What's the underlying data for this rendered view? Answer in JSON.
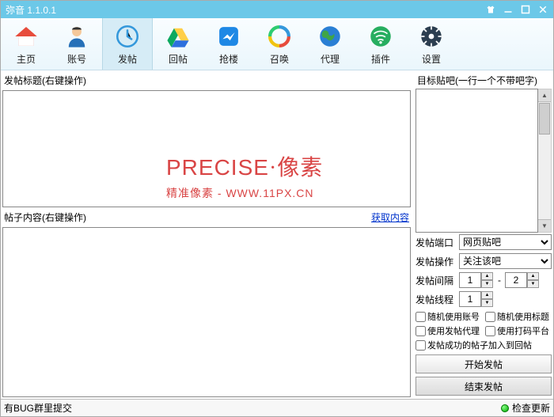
{
  "window": {
    "title": "弥音 1.1.0.1"
  },
  "toolbar": {
    "items": [
      {
        "label": "主页"
      },
      {
        "label": "账号"
      },
      {
        "label": "发帖",
        "active": true
      },
      {
        "label": "回帖"
      },
      {
        "label": "抢楼"
      },
      {
        "label": "召唤"
      },
      {
        "label": "代理"
      },
      {
        "label": "插件"
      },
      {
        "label": "设置"
      }
    ]
  },
  "left": {
    "title_label": "发帖标题(右键操作)",
    "content_label": "帖子内容(右键操作)",
    "get_content_link": "获取内容"
  },
  "right": {
    "target_label": "目标贴吧(一行一个不带吧字)",
    "post_port_label": "发帖端口",
    "post_port_value": "网页贴吧",
    "post_action_label": "发帖操作",
    "post_action_value": "关注该吧",
    "interval_label": "发帖间隔",
    "interval_min": "1",
    "interval_max": "2",
    "threads_label": "发帖线程",
    "threads_value": "1",
    "checks": {
      "rand_account": "随机使用账号",
      "rand_title": "随机使用标题",
      "use_proxy": "使用发帖代理",
      "use_coding": "使用打码平台",
      "add_to_reply": "发帖成功的帖子加入到回帖"
    },
    "start_btn": "开始发帖",
    "stop_btn": "结束发帖"
  },
  "status": {
    "bug": "有BUG群里提交",
    "update": "检查更新"
  },
  "watermark": {
    "line1_en": "PRECISE",
    "line1_cn": "·像素",
    "line2": "精准像素 - WWW.11PX.CN"
  }
}
